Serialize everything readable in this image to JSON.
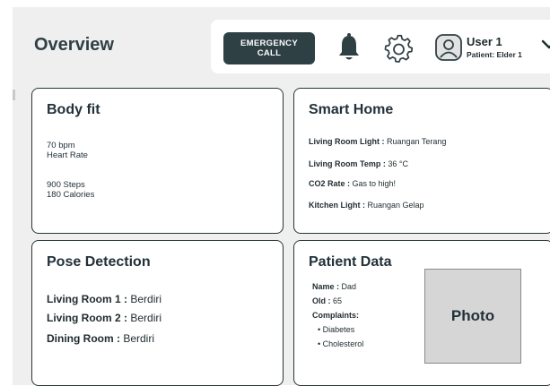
{
  "header": {
    "title": "Overview",
    "emergency_line1": "EMERGENCY",
    "emergency_line2": "CALL",
    "user_name": "User 1",
    "patient_label": "Patient: Elder 1"
  },
  "icons": {
    "notifications": "bell-icon",
    "settings": "gear-icon",
    "avatar": "user-avatar-icon",
    "menu": "chevron-down-icon"
  },
  "body_fit": {
    "title": "Body fit",
    "heart_value": "70 bpm",
    "heart_label": "Heart Rate",
    "steps": "900 Steps",
    "calories": "180 Calories"
  },
  "smart_home": {
    "title": "Smart Home",
    "rows": [
      {
        "label": "Living Room Light :",
        "value": "Ruangan Terang"
      },
      {
        "label": "Living Room Temp :",
        "value": "36 °C"
      },
      {
        "label": "CO2 Rate :",
        "value": "Gas to high!"
      },
      {
        "label": "Kitchen Light :",
        "value": "Ruangan Gelap"
      }
    ]
  },
  "pose_detection": {
    "title": "Pose Detection",
    "rows": [
      {
        "label": "Living Room 1 :",
        "value": "Berdiri"
      },
      {
        "label": "Living Room 2 :",
        "value": "Berdiri"
      },
      {
        "label": "Dining Room :",
        "value": "Berdiri"
      }
    ]
  },
  "patient_data": {
    "title": "Patient Data",
    "name_label": "Name :",
    "name_value": "Dad",
    "age_label": "Old :",
    "age_value": "65",
    "complaints_label": "Complaints:",
    "complaints": [
      "Diabetes",
      "Cholesterol"
    ],
    "photo_label": "Photo"
  },
  "colors": {
    "accent": "#2f4045",
    "background": "#efefef",
    "card": "#ffffff",
    "photo": "#d6d6d6"
  }
}
